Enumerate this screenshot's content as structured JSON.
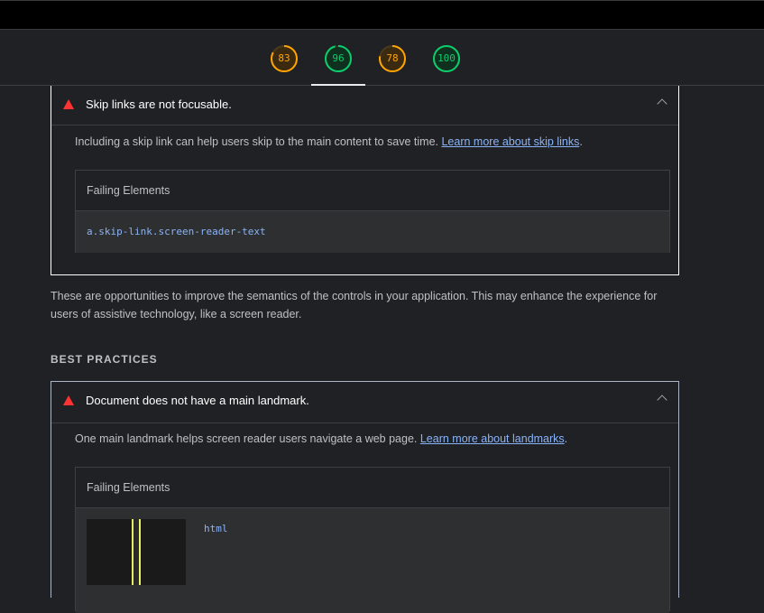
{
  "scores": [
    {
      "value": "83",
      "color": "#ffa400",
      "fraction": 0.83
    },
    {
      "value": "96",
      "color": "#0cce6b",
      "fraction": 0.96
    },
    {
      "value": "78",
      "color": "#ffa400",
      "fraction": 0.78
    },
    {
      "value": "100",
      "color": "#0cce6b",
      "fraction": 1.0
    }
  ],
  "audit_skip": {
    "title": "Skip links are not focusable.",
    "desc_text": "Including a skip link can help users skip to the main content to save time. ",
    "link_text": "Learn more about skip links",
    "desc_suffix": ".",
    "table_header": "Failing Elements",
    "element": "a.skip-link.screen-reader-text"
  },
  "group_desc": "These are opportunities to improve the semantics of the controls in your application. This may enhance the experience for users of assistive technology, like a screen reader.",
  "group_title": "BEST PRACTICES",
  "audit_landmark": {
    "title": "Document does not have a main landmark.",
    "desc_text": "One main landmark helps screen reader users navigate a web page. ",
    "link_text": "Learn more about landmarks",
    "desc_suffix": ".",
    "table_header": "Failing Elements",
    "element": "html"
  },
  "icons": {
    "fail": "warning-triangle-icon",
    "collapse": "chevron-up-icon"
  }
}
